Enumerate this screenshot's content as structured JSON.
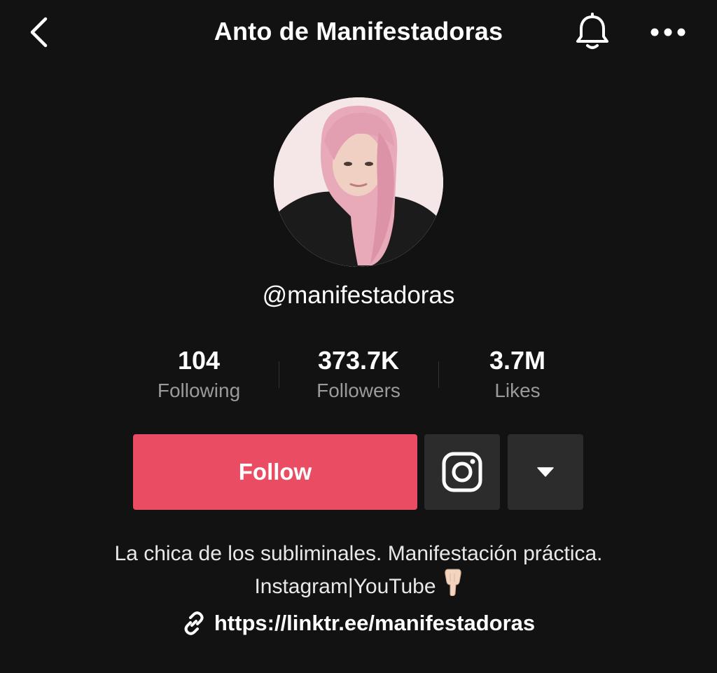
{
  "header": {
    "title": "Anto de Manifestadoras",
    "back_icon": "chevron-left-icon",
    "bell_icon": "bell-icon",
    "more_icon": "more-horizontal-icon"
  },
  "profile": {
    "username": "@manifestadoras",
    "avatar": "profile-avatar"
  },
  "stats": [
    {
      "value": "104",
      "label": "Following"
    },
    {
      "value": "373.7K",
      "label": "Followers"
    },
    {
      "value": "3.7M",
      "label": "Likes"
    }
  ],
  "actions": {
    "follow_label": "Follow",
    "follow_color": "#ea4c63",
    "instagram_icon": "instagram-icon",
    "dropdown_icon": "caret-down-icon"
  },
  "bio": {
    "line1": "La chica de los subliminales. Manifestación práctica.",
    "line2": "Instagram|YouTube",
    "hand_icon": "pointing-down-hand-icon"
  },
  "link": {
    "url": "https://linktr.ee/manifestadoras",
    "icon": "link-icon"
  },
  "colors": {
    "background": "#121212",
    "accent": "#ea4c63",
    "secondary_button": "#2c2c2c",
    "muted_text": "#9a9a9a"
  }
}
